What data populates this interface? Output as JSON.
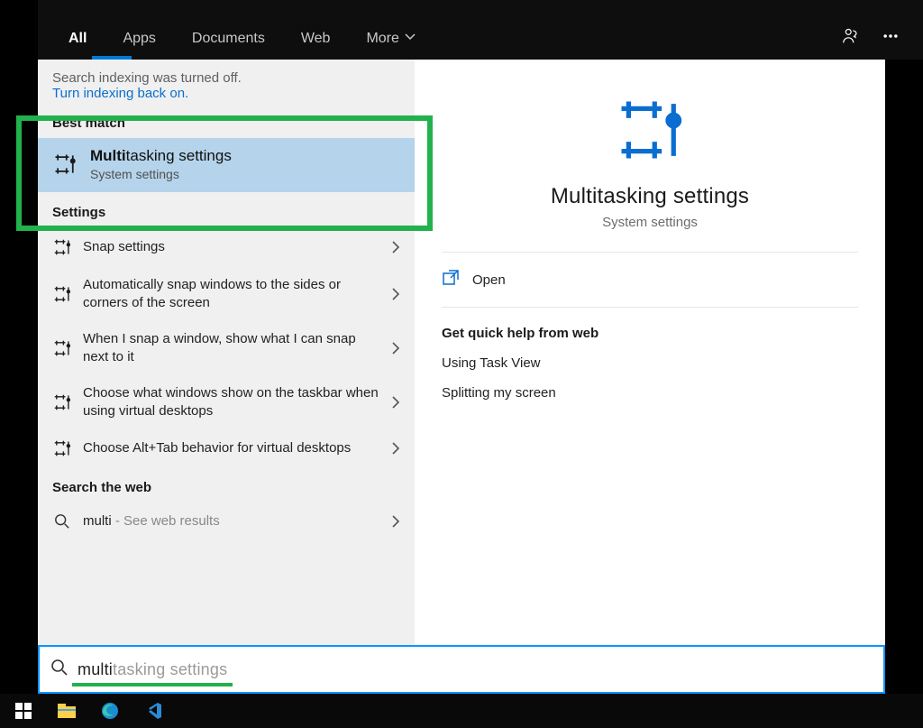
{
  "tabs": {
    "all": "All",
    "apps": "Apps",
    "documents": "Documents",
    "web": "Web",
    "more": "More"
  },
  "search_message": "Search indexing was turned off.",
  "search_message_link": "Turn indexing back on.",
  "headers": {
    "best_match": "Best match",
    "settings": "Settings",
    "search_web": "Search the web"
  },
  "best_match": {
    "title_bold": "Multi",
    "title_rest": "tasking settings",
    "subtitle": "System settings"
  },
  "settings_list": [
    {
      "label": "Snap settings"
    },
    {
      "label": "Automatically snap windows to the sides or corners of the screen"
    },
    {
      "label": "When I snap a window, show what I can snap next to it"
    },
    {
      "label": "Choose what windows show on the taskbar when using virtual desktops"
    },
    {
      "label": "Choose Alt+Tab behavior for virtual desktops"
    }
  ],
  "web_result": {
    "term": "multi",
    "hint": " - See web results"
  },
  "preview": {
    "title": "Multitasking settings",
    "subtitle": "System settings",
    "open": "Open",
    "help_header": "Get quick help from web",
    "help_links": [
      "Using Task View",
      "Splitting my screen"
    ]
  },
  "search_input": {
    "typed": "multi",
    "ghost": "tasking settings"
  }
}
